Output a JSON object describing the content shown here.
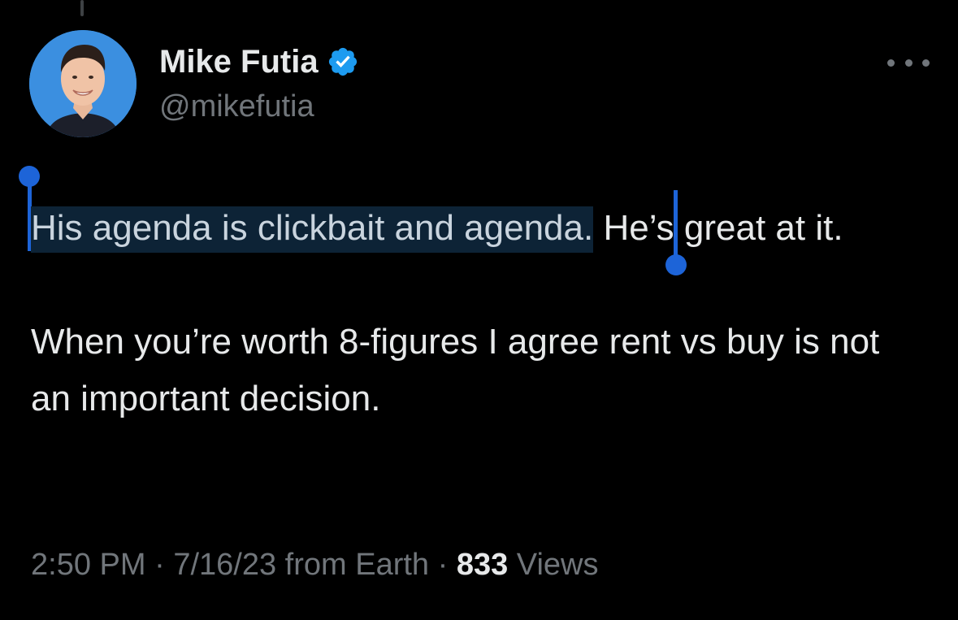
{
  "author": {
    "display_name": "Mike Futia",
    "handle": "@mikefutia",
    "verified": true,
    "avatar_bg": "#3b8fe0"
  },
  "tweet": {
    "paragraphs": [
      {
        "selected_text": "His agenda is clickbait and agenda.",
        "rest_text": " He’s great at it."
      },
      {
        "text": "When you’re worth 8-figures I agree rent vs buy is not an important decision."
      }
    ],
    "selection_color": "#1d64d8"
  },
  "meta": {
    "time": "2:50 PM",
    "separator1": " · ",
    "date": "7/16/23",
    "source": " from Earth",
    "separator2": " · ",
    "views_count": "833",
    "views_label": " Views"
  },
  "icons": {
    "verified": "verified-badge-icon",
    "more": "more-options-icon"
  }
}
